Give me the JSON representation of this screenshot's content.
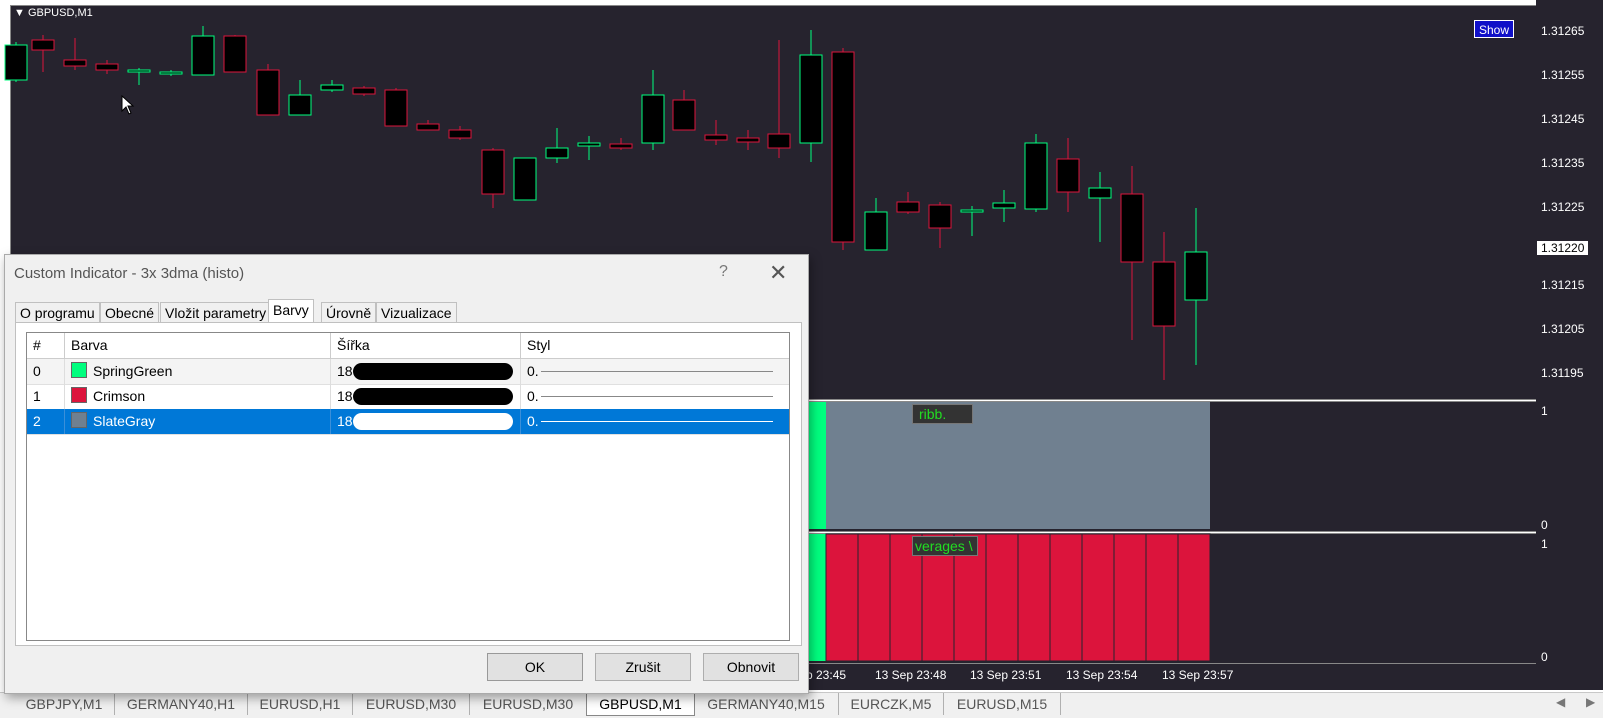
{
  "chart": {
    "symbol": "GBPUSD,M1",
    "show_button": "Show",
    "price_labels": [
      "1.31265",
      "1.31255",
      "1.31245",
      "1.31235",
      "1.31225",
      "1.31220",
      "1.31215",
      "1.31205",
      "1.31195"
    ],
    "current_price": "1.31220",
    "sub_window_1": {
      "label": "ribb.",
      "scale_top": "1",
      "scale_bottom": "0"
    },
    "sub_window_2": {
      "label": "verages \\",
      "scale_top": "1",
      "scale_bottom": "0"
    },
    "time_labels": [
      "p 23:45",
      "13 Sep 23:48",
      "13 Sep 23:51",
      "13 Sep 23:54",
      "13 Sep 23:57"
    ]
  },
  "dialog": {
    "title": "Custom Indicator - 3x 3dma (histo)",
    "help": "?",
    "close": "✕",
    "tabs": [
      "O programu",
      "Obecné",
      "Vložit parametry",
      "Barvy",
      "Úrovně",
      "Vizualizace"
    ],
    "active_tab": "Barvy",
    "columns": [
      "#",
      "Barva",
      "Šířka",
      "Styl"
    ],
    "rows": [
      {
        "index": "0",
        "color_name": "SpringGreen",
        "color": "#00ff7f",
        "width": "18",
        "style": "0."
      },
      {
        "index": "1",
        "color_name": "Crimson",
        "color": "#dc143c",
        "width": "18",
        "style": "0."
      },
      {
        "index": "2",
        "color_name": "SlateGray",
        "color": "#708090",
        "width": "18",
        "style": "0."
      }
    ],
    "selected_row": 2,
    "buttons": {
      "ok": "OK",
      "cancel": "Zrušit",
      "reset": "Obnovit"
    }
  },
  "bottom_tabs": [
    "GBPJPY,M1",
    "GERMANY40,H1",
    "EURUSD,H1",
    "EURUSD,M30",
    "EURUSD,M30",
    "GBPUSD,M1",
    "GERMANY40,M15",
    "EURCZK,M5",
    "EURUSD,M15"
  ],
  "active_bottom_tab": "GBPUSD,M1",
  "icons": {
    "scroll_left": "triangle-left",
    "scroll_right": "triangle-right",
    "symbol_menu": "triangle-down"
  },
  "colors": {
    "chart_bg": "#26232e",
    "bull": "#00ff7f",
    "bear": "#dc143c",
    "slate": "#708090",
    "selection": "#0078d7"
  }
}
